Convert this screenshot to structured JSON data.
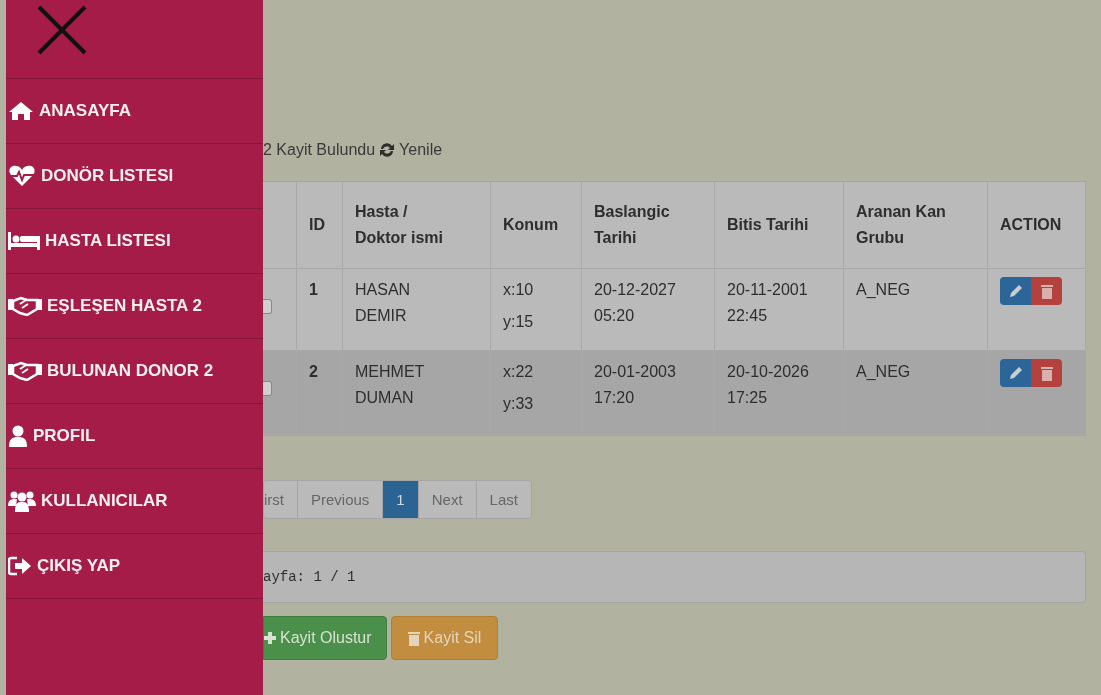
{
  "drawer": {
    "items": [
      {
        "label": "ANASAYFA"
      },
      {
        "label": "DONÖR LISTESI"
      },
      {
        "label": "HASTA LISTESI"
      },
      {
        "label": "EŞLEŞEN HASTA 2"
      },
      {
        "label": "BULUNAN DONOR 2"
      },
      {
        "label": "PROFIL"
      },
      {
        "label": "KULLANICILAR"
      },
      {
        "label": "ÇIKIŞ YAP"
      }
    ]
  },
  "summary": {
    "count": "2 Kayit Bulundu",
    "refresh": "Yenile"
  },
  "table": {
    "columns": [
      "ID",
      "Hasta /\nDoktor ismi",
      "Konum",
      "Baslangic\nTarihi",
      "Bitis Tarihi",
      "Aranan Kan\nGrubu",
      "ACTION"
    ],
    "rows": [
      {
        "highlighted": false,
        "checked": false,
        "id": "1",
        "name": "HASAN\nDEMIR",
        "x": "x:10",
        "y": "y:15",
        "start": "20-12-2027\n05:20",
        "end": "20-11-2001\n22:45",
        "blood": "A_NEG"
      },
      {
        "highlighted": true,
        "checked": false,
        "id": "2",
        "name": "MEHMET\nDUMAN",
        "x": "x:22",
        "y": "y:33",
        "start": "20-01-2003\n17:20",
        "end": "20-10-2026\n17:25",
        "blood": "A_NEG"
      }
    ]
  },
  "pagination": [
    {
      "label": "irst",
      "selected": false
    },
    {
      "label": "Previous",
      "selected": false
    },
    {
      "label": "1",
      "selected": true
    },
    {
      "label": "Next",
      "selected": false
    },
    {
      "label": "Last",
      "selected": false
    }
  ],
  "page_field": {
    "value": "ayfa: 1 / 1"
  },
  "buttons": [
    {
      "label": "Kayit Olustur",
      "kind": "create"
    },
    {
      "label": "Kayit Sil",
      "kind": "delete"
    }
  ]
}
